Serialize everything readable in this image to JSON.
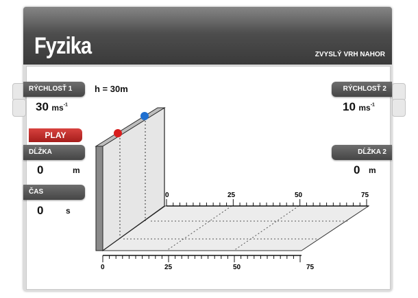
{
  "app": {
    "title": "Fyzika",
    "subtitle": "ZVYSLÝ VRH NAHOR"
  },
  "height_label": "h = 30m",
  "controls": {
    "speed1": {
      "label": "RÝCHLOSŤ 1",
      "value": "30",
      "unit": "ms",
      "unit_sup": "-1"
    },
    "speed2": {
      "label": "RÝCHLOSŤ 2",
      "value": "10",
      "unit": "ms",
      "unit_sup": "-1"
    },
    "play_label": "PLAY",
    "length1": {
      "label": "DĹŽKA",
      "value": "0",
      "unit": "m"
    },
    "length2": {
      "label": "DĹŽKA 2",
      "value": "0",
      "unit": "m"
    },
    "time": {
      "label": "ČAS",
      "value": "0",
      "unit": "s"
    }
  },
  "scale": {
    "back_ticks": [
      "0",
      "25",
      "50",
      "75"
    ],
    "front_ticks": [
      "0",
      "25",
      "50",
      "75"
    ]
  },
  "balls": [
    {
      "name": "ball-red",
      "color": "#d81e1e"
    },
    {
      "name": "ball-blue",
      "color": "#1f6fd0"
    }
  ]
}
